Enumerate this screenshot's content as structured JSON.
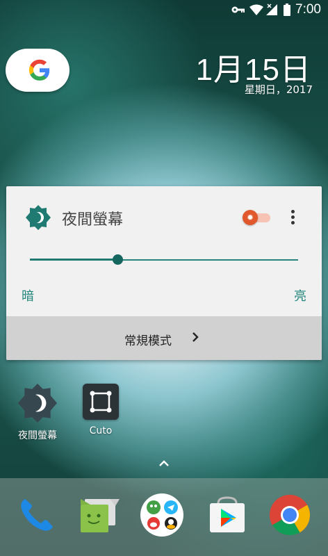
{
  "status_bar": {
    "icons": [
      "vpn-key-icon",
      "wifi-icon",
      "signal-icon",
      "battery-icon"
    ],
    "time": "7:00"
  },
  "search": {
    "icon": "google-g-icon"
  },
  "clock": {
    "date": "1月15日",
    "weekday": "星期日，2017"
  },
  "night_widget": {
    "title": "夜間螢幕",
    "toggle_on": true,
    "brightness_fraction": 0.33,
    "label_dark": "暗",
    "label_bright": "亮",
    "mode_label": "常規模式",
    "colors": {
      "accent": "#1f7a72",
      "toggle": "#e0582c",
      "footer": "#d1d1d1"
    }
  },
  "home_apps": [
    {
      "label": "夜間螢幕",
      "icon": "night-screen-icon"
    },
    {
      "label": "Cuto",
      "icon": "cuto-icon"
    }
  ],
  "dock": {
    "apps": [
      "phone-icon",
      "messenger-icon",
      "social-folder-icon",
      "play-store-icon",
      "chrome-icon"
    ]
  }
}
